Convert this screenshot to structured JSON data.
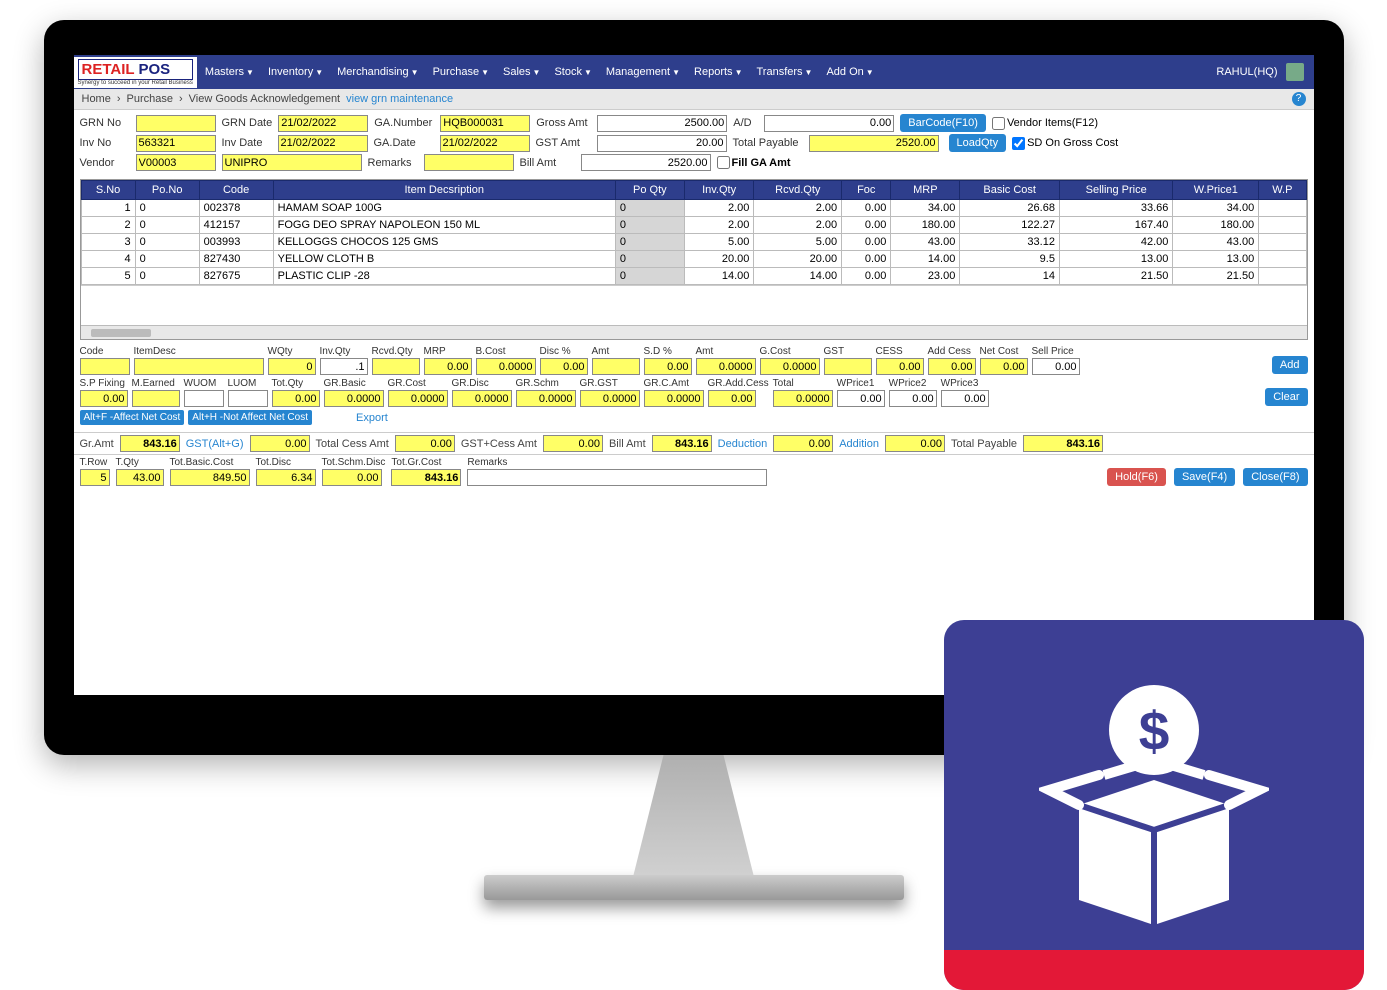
{
  "logo": {
    "text1": "RETAIL ",
    "text2": "POS",
    "sub": "Synergy to succeed in your Retail Business"
  },
  "nav": [
    "Masters",
    "Inventory",
    "Merchandising",
    "Purchase",
    "Sales",
    "Stock",
    "Management",
    "Reports",
    "Transfers",
    "Add On"
  ],
  "user": "RAHUL(HQ)",
  "breadcrumb": {
    "home": "Home",
    "sep": "›",
    "p1": "Purchase",
    "p2": "View Goods Acknowledgement",
    "link": "view grn maintenance"
  },
  "form": {
    "grn_no_lbl": "GRN No",
    "grn_no": "",
    "grn_date_lbl": "GRN Date",
    "grn_date": "21/02/2022",
    "ga_number_lbl": "GA.Number",
    "ga_number": "HQB000031",
    "gross_amt_lbl": "Gross Amt",
    "gross_amt": "2500.00",
    "ad_lbl": "A/D",
    "ad": "0.00",
    "inv_no_lbl": "Inv No",
    "inv_no": "563321",
    "inv_date_lbl": "Inv Date",
    "inv_date": "21/02/2022",
    "ga_date_lbl": "GA.Date",
    "ga_date": "21/02/2022",
    "gst_amt_lbl": "GST Amt",
    "gst_amt": "20.00",
    "total_payable_lbl": "Total Payable",
    "total_payable": "2520.00",
    "vendor_lbl": "Vendor",
    "vendor_code": "V00003",
    "vendor_name": "UNIPRO",
    "remarks_lbl": "Remarks",
    "remarks": "",
    "bill_amt_lbl": "Bill Amt",
    "bill_amt": "2520.00",
    "fill_ga_lbl": "Fill GA Amt",
    "barcode_btn": "BarCode(F10)",
    "loadqty_btn": "LoadQty",
    "vendor_items_lbl": "Vendor Items(F12)",
    "sd_gross_lbl": "SD On Gross Cost"
  },
  "grid_headers": [
    "S.No",
    "Po.No",
    "Code",
    "Item Decsription",
    "Po Qty",
    "Inv.Qty",
    "Rcvd.Qty",
    "Foc",
    "MRP",
    "Basic Cost",
    "Selling Price",
    "W.Price1",
    "W.P"
  ],
  "grid_rows": [
    {
      "sno": "1",
      "pono": "0",
      "code": "002378",
      "desc": "HAMAM SOAP 100G",
      "poqty": "0",
      "invqty": "2.00",
      "rcvd": "2.00",
      "foc": "0.00",
      "mrp": "34.00",
      "basic": "26.68",
      "sell": "33.66",
      "wp1": "34.00"
    },
    {
      "sno": "2",
      "pono": "0",
      "code": "412157",
      "desc": "FOGG DEO SPRAY NAPOLEON 150 ML",
      "poqty": "0",
      "invqty": "2.00",
      "rcvd": "2.00",
      "foc": "0.00",
      "mrp": "180.00",
      "basic": "122.27",
      "sell": "167.40",
      "wp1": "180.00"
    },
    {
      "sno": "3",
      "pono": "0",
      "code": "003993",
      "desc": "KELLOGGS CHOCOS 125 GMS",
      "poqty": "0",
      "invqty": "5.00",
      "rcvd": "5.00",
      "foc": "0.00",
      "mrp": "43.00",
      "basic": "33.12",
      "sell": "42.00",
      "wp1": "43.00"
    },
    {
      "sno": "4",
      "pono": "0",
      "code": "827430",
      "desc": "YELLOW CLOTH B",
      "poqty": "0",
      "invqty": "20.00",
      "rcvd": "20.00",
      "foc": "0.00",
      "mrp": "14.00",
      "basic": "9.5",
      "sell": "13.00",
      "wp1": "13.00"
    },
    {
      "sno": "5",
      "pono": "0",
      "code": "827675",
      "desc": "PLASTIC CLIP -28",
      "poqty": "0",
      "invqty": "14.00",
      "rcvd": "14.00",
      "foc": "0.00",
      "mrp": "23.00",
      "basic": "14",
      "sell": "21.50",
      "wp1": "21.50"
    }
  ],
  "entry1": {
    "code_lbl": "Code",
    "itemdesc_lbl": "ItemDesc",
    "wqty_lbl": "WQty",
    "invqty_lbl": "Inv.Qty",
    "rcvdqty_lbl": "Rcvd.Qty",
    "mrp_lbl": "MRP",
    "bcost_lbl": "B.Cost",
    "discpct_lbl": "Disc %",
    "amt_lbl": "Amt",
    "sdpct_lbl": "S.D %",
    "amt2_lbl": "Amt",
    "gcost_lbl": "G.Cost",
    "gst_lbl": "GST",
    "cess_lbl": "CESS",
    "addcess_lbl": "Add Cess",
    "netcost_lbl": "Net Cost",
    "sellprice_lbl": "Sell Price",
    "wqty": "0",
    "invqty": ".1",
    "rcvdqty": "",
    "mrp": "0.00",
    "bcost": "0.0000",
    "discpct": "0.00",
    "amt": "",
    "sdpct": "0.00",
    "amt2": "0.0000",
    "gcost": "0.0000",
    "gst": "",
    "cess": "0.00",
    "addcess": "0.00",
    "netcost": "0.00",
    "sellprice": "0.00",
    "add_btn": "Add"
  },
  "entry2": {
    "spfixing_lbl": "S.P Fixing",
    "mearned_lbl": "M.Earned",
    "wuom_lbl": "WUOM",
    "luom_lbl": "LUOM",
    "totqty_lbl": "Tot.Qty",
    "grbasic_lbl": "GR.Basic",
    "grcost_lbl": "GR.Cost",
    "grdisc_lbl": "GR.Disc",
    "grschm_lbl": "GR.Schm",
    "grgst_lbl": "GR.GST",
    "grcamt_lbl": "GR.C.Amt",
    "graddcess_lbl": "GR.Add.Cess",
    "total_lbl": "Total",
    "wprice1_lbl": "WPrice1",
    "wprice2_lbl": "WPrice2",
    "wprice3_lbl": "WPrice3",
    "spfixing": "0.00",
    "mearned": "",
    "totqty": "0.00",
    "grbasic": "0.0000",
    "grcost": "0.0000",
    "grdisc": "0.0000",
    "grschm": "0.0000",
    "grgst": "0.0000",
    "grcamt": "0.0000",
    "graddcess": "0.00",
    "total": "0.0000",
    "wprice1": "0.00",
    "wprice2": "0.00",
    "wprice3": "0.00",
    "clear_btn": "Clear"
  },
  "shortcuts": {
    "altf": "Alt+F -Affect Net Cost",
    "alth": "Alt+H -Not Affect Net Cost",
    "export": "Export"
  },
  "sum1": {
    "gramt_lbl": "Gr.Amt",
    "gramt": "843.16",
    "gst_link": "GST(Alt+G)",
    "gst": "0.00",
    "totcess_lbl": "Total Cess Amt",
    "totcess": "0.00",
    "gstcess_lbl": "GST+Cess Amt",
    "gstcess": "0.00",
    "billamt_lbl": "Bill Amt",
    "billamt": "843.16",
    "ded_link": "Deduction",
    "ded": "0.00",
    "add_link": "Addition",
    "add": "0.00",
    "totpay_lbl": "Total Payable",
    "totpay": "843.16"
  },
  "sum2": {
    "trow_lbl": "T.Row",
    "trow": "5",
    "tqty_lbl": "T.Qty",
    "tqty": "43.00",
    "totbasic_lbl": "Tot.Basic.Cost",
    "totbasic": "849.50",
    "totdisc_lbl": "Tot.Disc",
    "totdisc": "6.34",
    "totschm_lbl": "Tot.Schm.Disc",
    "totschm": "0.00",
    "totgr_lbl": "Tot.Gr.Cost",
    "totgr": "843.16",
    "remarks_lbl": "Remarks",
    "remarks": "",
    "hold_btn": "Hold(F6)",
    "save_btn": "Save(F4)",
    "close_btn": "Close(F8)"
  }
}
